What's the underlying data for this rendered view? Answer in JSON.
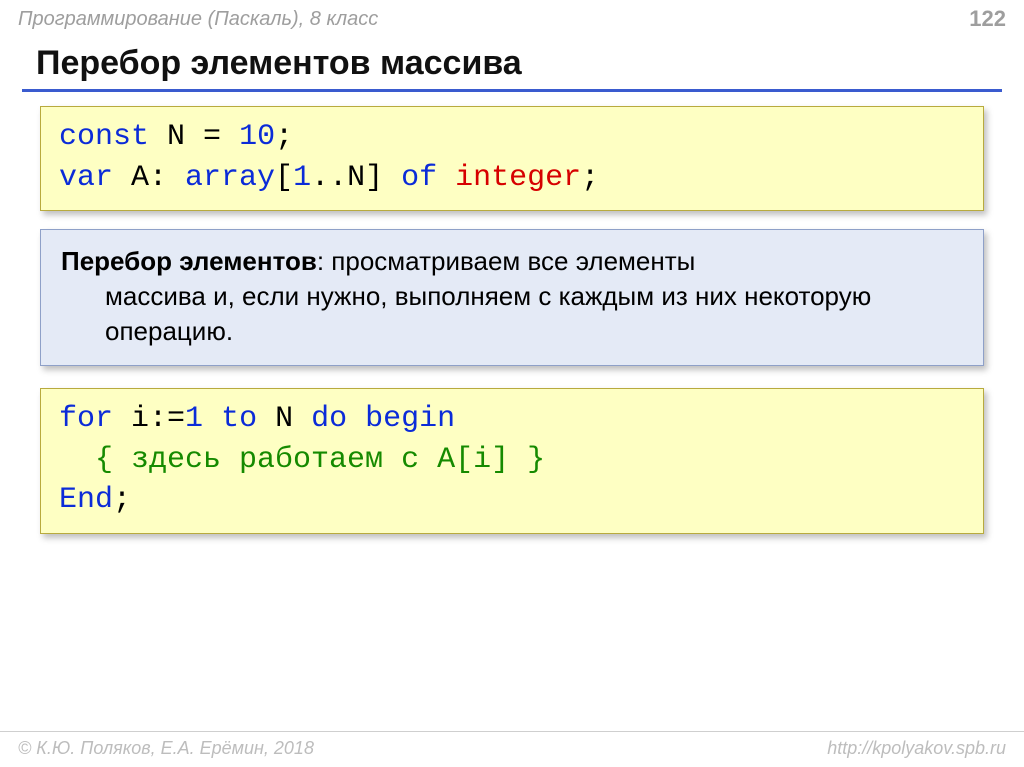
{
  "header": {
    "subject": "Программирование (Паскаль), 8 класс",
    "page_number": "122"
  },
  "title": "Перебор элементов массива",
  "code1": {
    "l1": {
      "t1": "const",
      "t2": " N",
      "t3": "=",
      "t4": "10",
      "t5": ";"
    },
    "l2": {
      "t1": "var",
      "t2": " A: ",
      "t3": "array",
      "t4": "[",
      "t5": "1",
      "t6": "..N] ",
      "t7": "of",
      "t8": " ",
      "t9": "integer",
      "t10": ";"
    }
  },
  "info": {
    "lead": "Перебор элементов",
    "rest_inline": ": просматриваем все элементы",
    "rest_wrap": "массива и, если нужно, выполняем с каждым из них некоторую операцию."
  },
  "code2": {
    "l1": {
      "t1": "for",
      "t2": " i:=",
      "t3": "1",
      "t4": " ",
      "t5": "to",
      "t6": " N ",
      "t7": "do",
      "t8": " ",
      "t9": "begin"
    },
    "l2": {
      "t1": "  ",
      "t2": "{ здесь работаем с A[i] }"
    },
    "l3": {
      "t1": "End",
      "t2": ";"
    }
  },
  "footer": {
    "copyright": "© К.Ю. Поляков, Е.А. Ерёмин, 2018",
    "url": "http://kpolyakov.spb.ru"
  }
}
